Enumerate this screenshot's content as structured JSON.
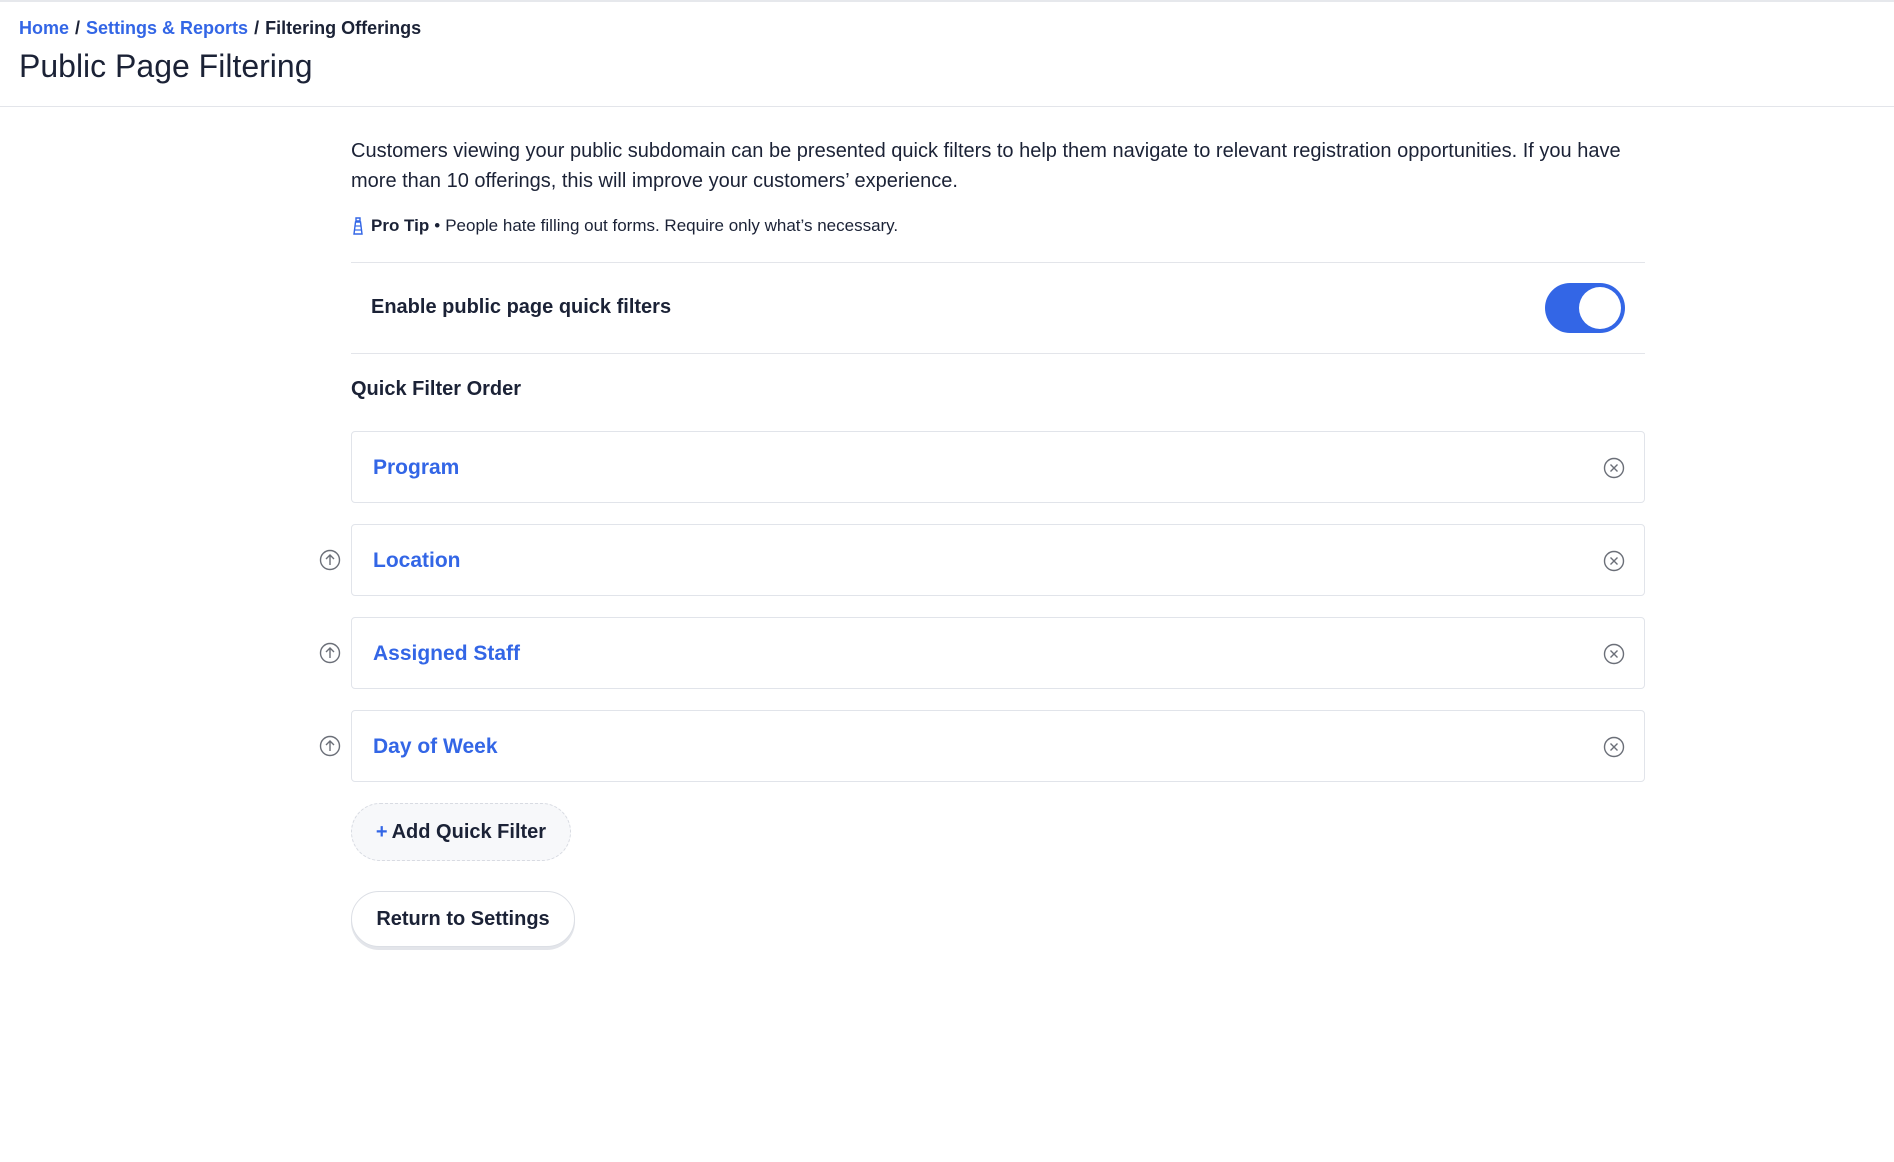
{
  "breadcrumb": {
    "home": "Home",
    "sep1": "/",
    "settings": "Settings & Reports",
    "sep2": "/",
    "current": "Filtering Offerings"
  },
  "page": {
    "title": "Public Page Filtering"
  },
  "description": "Customers viewing your public subdomain can be presented quick filters to help them navigate to relevant registration opportunities. If you have more than 10 offerings, this will improve your customers’ experience.",
  "pro_tip": {
    "icon": "lighthouse-icon",
    "label": "Pro Tip",
    "bullet": "•",
    "text": "People hate filling out forms. Require only what’s necessary."
  },
  "toggle": {
    "label": "Enable public page quick filters",
    "enabled": true
  },
  "quick_filter_order": {
    "title": "Quick Filter Order",
    "items": [
      {
        "label": "Program",
        "can_move_up": false
      },
      {
        "label": "Location",
        "can_move_up": true
      },
      {
        "label": "Assigned Staff",
        "can_move_up": true
      },
      {
        "label": "Day of Week",
        "can_move_up": true
      }
    ]
  },
  "buttons": {
    "add_plus": "+",
    "add_label": "Add Quick Filter",
    "return_label": "Return to Settings"
  },
  "colors": {
    "accent": "#3366e6",
    "text": "#1b2236",
    "border": "#e1e4ea"
  }
}
